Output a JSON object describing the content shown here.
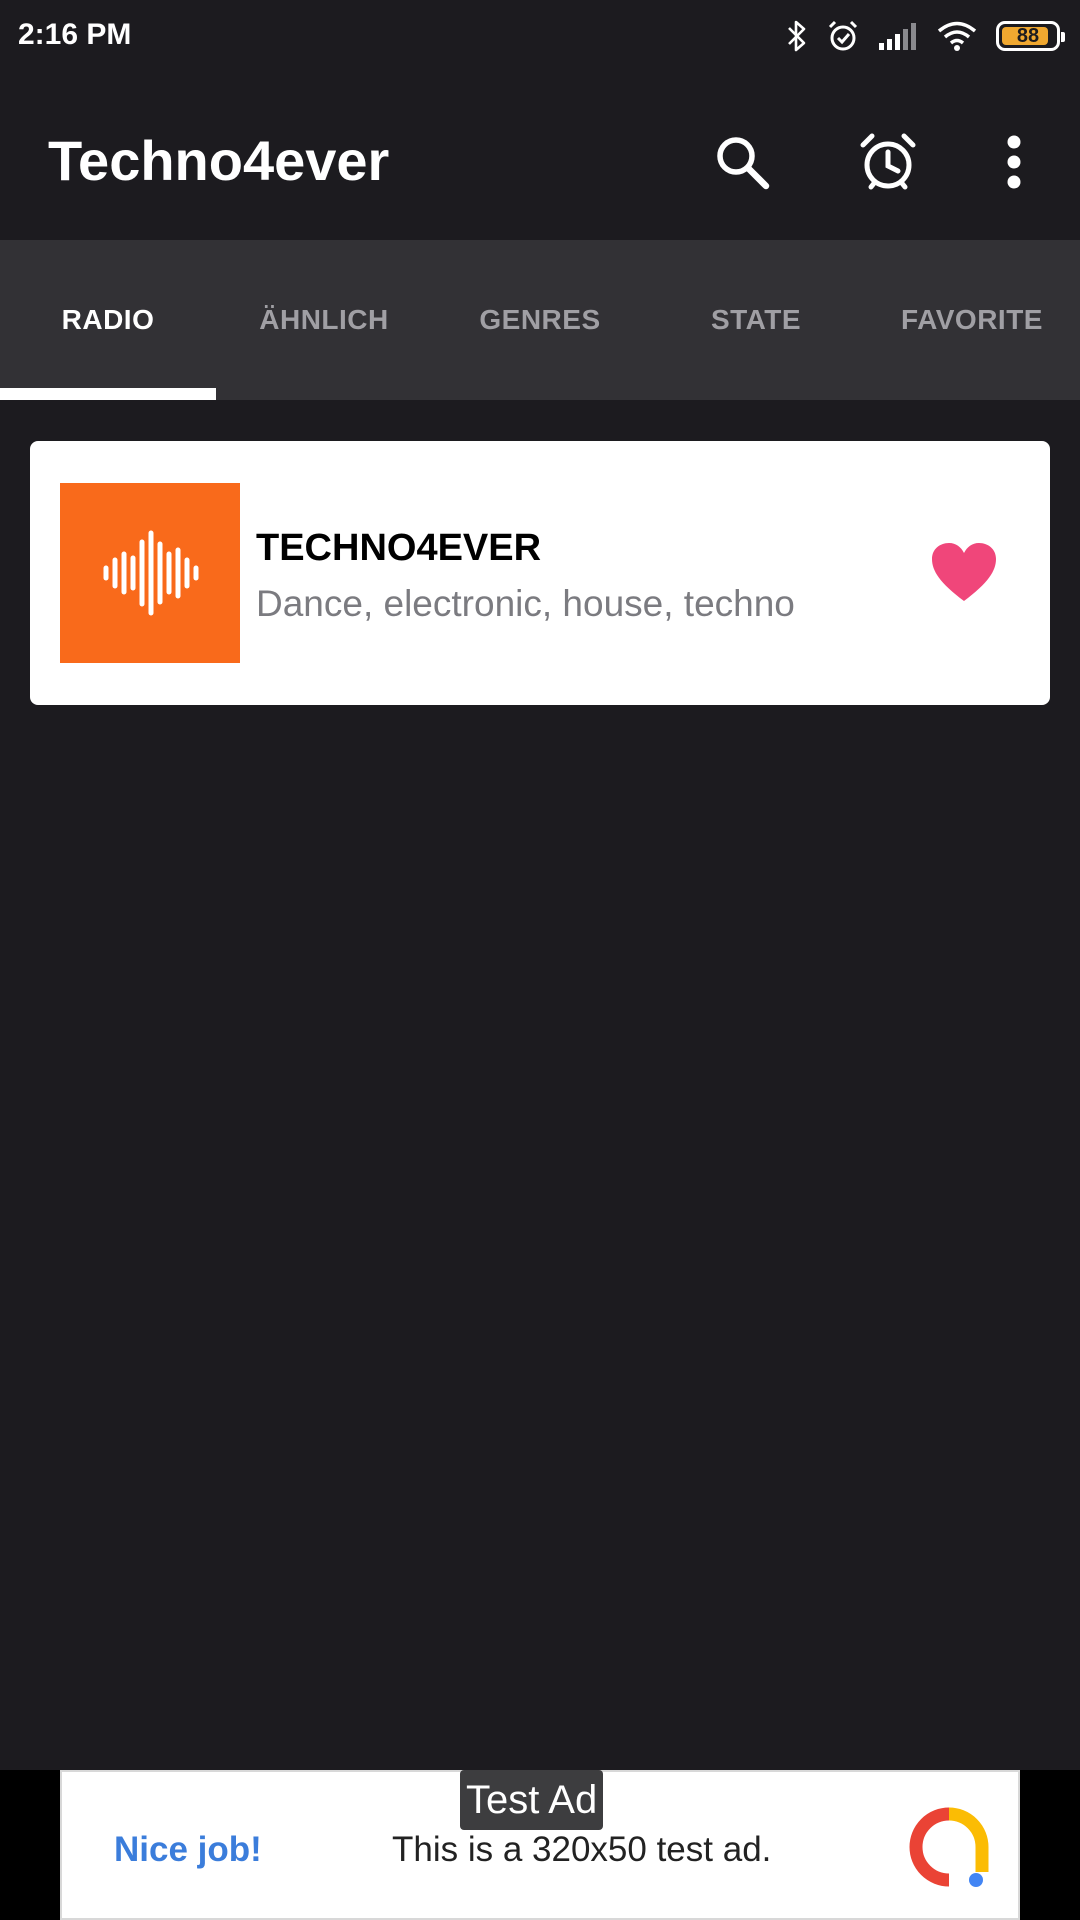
{
  "status_bar": {
    "time": "2:16 PM",
    "battery_level": "88",
    "battery_fraction": 0.88,
    "icons": [
      "bluetooth-icon",
      "alarm-icon",
      "signal-icon",
      "wifi-icon",
      "battery-icon"
    ]
  },
  "app_bar": {
    "title": "Techno4ever",
    "actions": [
      "search-icon",
      "alarm-clock-icon",
      "more-vert-icon"
    ]
  },
  "tabs": [
    {
      "label": "RADIO",
      "active": true
    },
    {
      "label": "ÄHNLICH",
      "active": false
    },
    {
      "label": "GENRES",
      "active": false
    },
    {
      "label": "STATE",
      "active": false
    },
    {
      "label": "FAVORITE",
      "active": false
    }
  ],
  "station": {
    "name": "TECHNO4EVER",
    "genres": "Dance, electronic, house, techno",
    "logo_icon": "sound-wave-icon",
    "favorite_icon": "heart-icon",
    "favorite": true
  },
  "ad": {
    "label": "Test Ad",
    "headline": "Nice job!",
    "text": "This is a 320x50 test ad."
  },
  "colors": {
    "background": "#1c1b1f",
    "tab_bar": "#323135",
    "accent_orange": "#f96a1b",
    "heart": "#f0467a",
    "ad_blue": "#3b7ddb",
    "battery": "#f0a830"
  }
}
